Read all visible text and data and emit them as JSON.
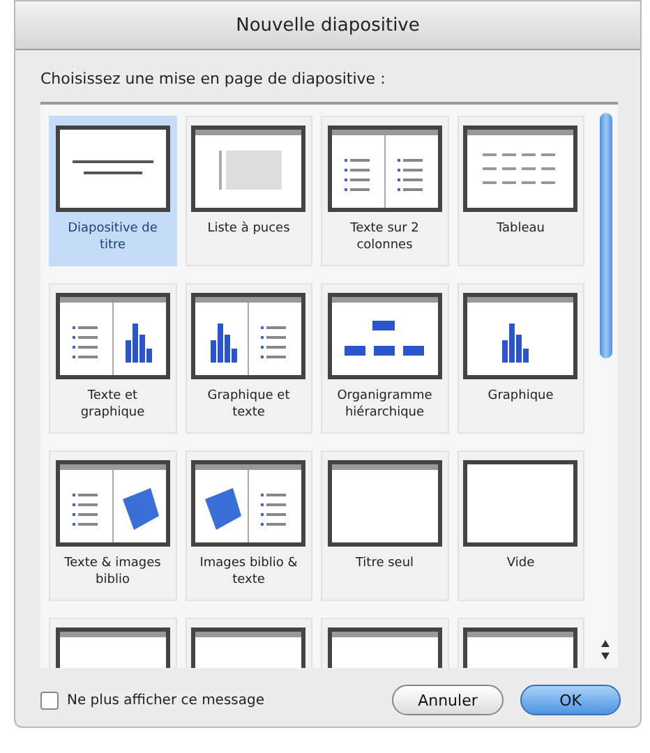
{
  "window": {
    "title": "Nouvelle diapositive"
  },
  "prompt": "Choisissez une mise en page de diapositive :",
  "layouts": [
    {
      "label": "Diapositive de titre",
      "kind": "title",
      "selected": true
    },
    {
      "label": "Liste à puces",
      "kind": "bullets",
      "selected": false
    },
    {
      "label": "Texte sur 2 colonnes",
      "kind": "columns",
      "selected": false
    },
    {
      "label": "Tableau",
      "kind": "table",
      "selected": false
    },
    {
      "label": "Texte et graphique",
      "kind": "textchart",
      "selected": false
    },
    {
      "label": "Graphique et texte",
      "kind": "charttext",
      "selected": false
    },
    {
      "label": "Organigramme hiérarchique",
      "kind": "org",
      "selected": false
    },
    {
      "label": "Graphique",
      "kind": "chart",
      "selected": false
    },
    {
      "label": "Texte & images biblio",
      "kind": "textclip",
      "selected": false
    },
    {
      "label": "Images biblio & texte",
      "kind": "cliptext",
      "selected": false
    },
    {
      "label": "Titre seul",
      "kind": "titleonly",
      "selected": false
    },
    {
      "label": "Vide",
      "kind": "blank",
      "selected": false
    },
    {
      "kind": "titleonly",
      "selected": false
    },
    {
      "kind": "titleonly",
      "selected": false
    },
    {
      "kind": "titleonly",
      "selected": false
    },
    {
      "kind": "titleonly",
      "selected": false
    }
  ],
  "dont_show_again": {
    "label": "Ne plus afficher ce message",
    "checked": false
  },
  "buttons": [
    {
      "label": "Annuler",
      "kind": "cancel"
    },
    {
      "label": "OK",
      "kind": "default"
    }
  ]
}
